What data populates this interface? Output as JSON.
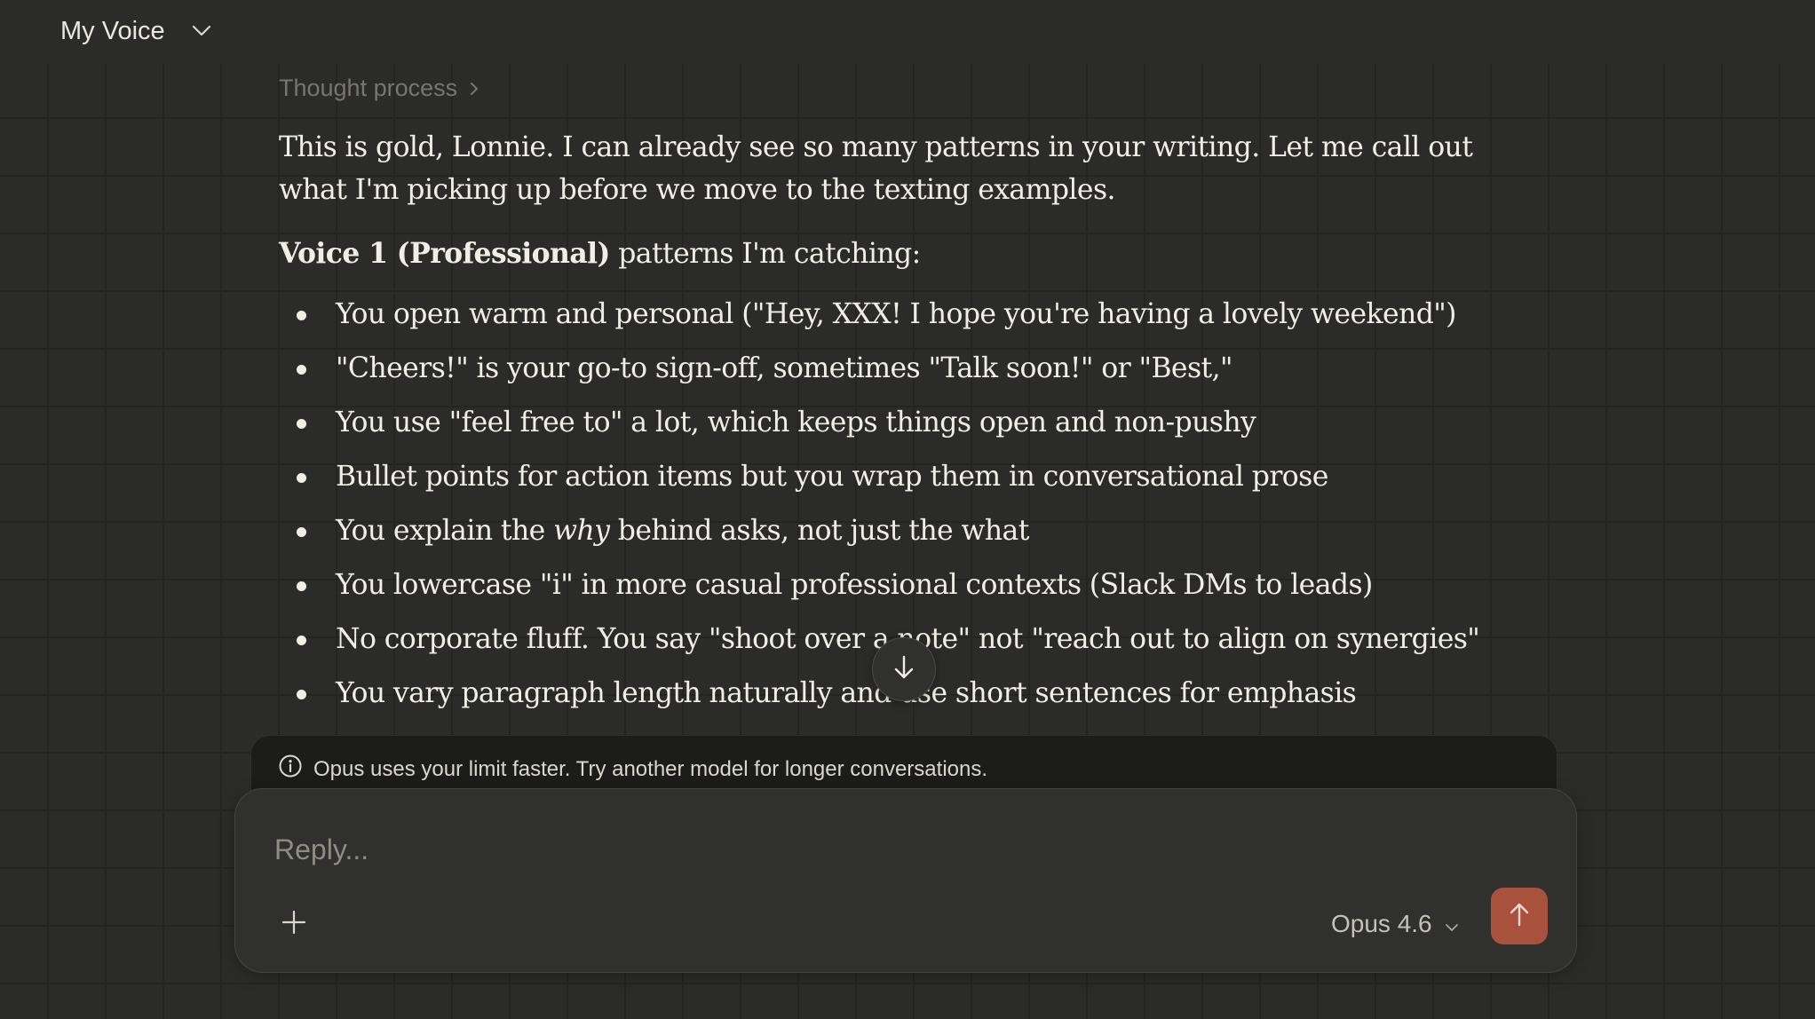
{
  "header": {
    "title": "My Voice",
    "chevron_icon": "chevron-down-icon"
  },
  "thought": {
    "label": "Thought process"
  },
  "message": {
    "intro": "This is gold, Lonnie. I can already see so many patterns in your writing. Let me call out what I'm picking up before we move to the texting examples.",
    "heading_bold": "Voice 1 (Professional)",
    "heading_rest": " patterns I'm catching:",
    "bullets": [
      "You open warm and personal (\"Hey, XXX! I hope you're having a lovely weekend\")",
      "\"Cheers!\" is your go-to sign-off, sometimes \"Talk soon!\" or \"Best,\"",
      "You use \"feel free to\" a lot, which keeps things open and non-pushy",
      "Bullet points for action items but you wrap them in conversational prose",
      {
        "pre": "You explain the ",
        "em": "why",
        "post": " behind asks, not just the what"
      },
      "You lowercase \"i\" in more casual professional contexts (Slack DMs to leads)",
      "No corporate fluff. You say \"shoot over a note\" not \"reach out to align on synergies\"",
      "You vary paragraph length naturally and use short sentences for emphasis"
    ]
  },
  "notice": {
    "text": "Opus uses your limit faster. Try another model for longer conversations."
  },
  "composer": {
    "placeholder": "Reply...",
    "model": "Opus 4.6"
  },
  "colors": {
    "background": "#2b2b2a",
    "send_button": "#a8513c",
    "text": "#f0eee6",
    "muted": "#77756f"
  }
}
